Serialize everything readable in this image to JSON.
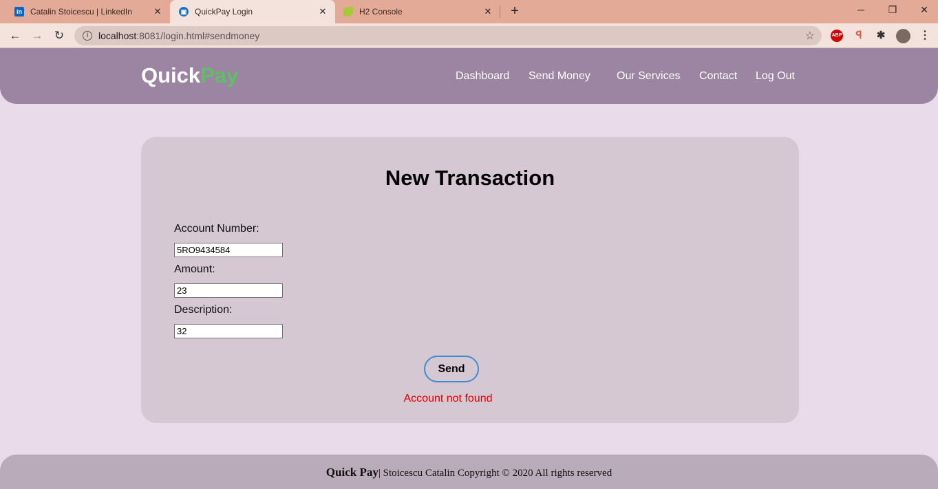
{
  "browser": {
    "tabs": [
      {
        "title": "Catalin Stoicescu | LinkedIn",
        "icon": "linkedin-icon"
      },
      {
        "title": "QuickPay Login",
        "icon": "bank-icon"
      },
      {
        "title": "H2 Console",
        "icon": "leaf-icon"
      }
    ],
    "url_host": "localhost",
    "url_rest": ":8081/login.html#sendmoney",
    "extensions": [
      "adblock-plus-icon",
      "extension-icon",
      "puzzle-icon",
      "profile-avatar"
    ]
  },
  "header": {
    "logo_quick": "Quick",
    "logo_pay": "Pay",
    "nav": [
      "Dashboard",
      "Send Money",
      "Our Services",
      "Contact",
      "Log Out"
    ]
  },
  "form": {
    "title": "New Transaction",
    "account_label": "Account Number:",
    "account_value": "5RO9434584",
    "amount_label": "Amount:",
    "amount_value": "23",
    "description_label": "Description:",
    "description_value": "32",
    "send_label": "Send",
    "error_message": "Account not found"
  },
  "footer": {
    "brand": "Quick Pay",
    "text": "| Stoicescu Catalin Copyright © 2020 All rights reserved"
  },
  "colors": {
    "header_bg": "#9c84a3",
    "logo_accent": "#5fbf62",
    "error": "#e00000",
    "button_border": "#3c8ed0"
  }
}
